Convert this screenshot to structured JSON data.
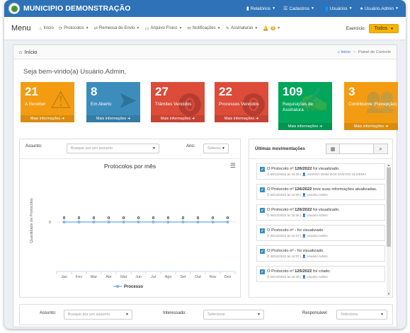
{
  "brand": {
    "name": "MUNICIPIO DEMONSTRAÇÃO"
  },
  "top_nav": [
    {
      "icon": "bar-chart-icon",
      "glyph": "▮",
      "label": "Relatórios"
    },
    {
      "icon": "sitemap-icon",
      "glyph": "☰",
      "label": "Cadastros"
    },
    {
      "icon": "users-icon",
      "glyph": "👥",
      "label": "Usuários"
    },
    {
      "icon": "user-icon",
      "glyph": "●",
      "label": "Usuário.Admin"
    }
  ],
  "menu": {
    "title": "Menu",
    "items": [
      {
        "label": "Início",
        "glyph": "⌂"
      },
      {
        "label": "Protocolos",
        "glyph": "⟳"
      },
      {
        "label": "Remessa de Envio",
        "glyph": "⇄"
      },
      {
        "label": "Arquivo Físico",
        "glyph": "▭"
      },
      {
        "label": "Notificações",
        "glyph": "✉"
      },
      {
        "label": "Assinaturas",
        "glyph": "✎"
      }
    ],
    "bell_count": "0"
  },
  "exercicio": {
    "label": "Exercício:",
    "value": "Todos"
  },
  "panel": {
    "title": "Início",
    "breadcrumb_home": "Início",
    "breadcrumb_current": "Painel de Controle"
  },
  "welcome": "Seja bem-vindo(a) Usuário.Admin,",
  "boxes": [
    {
      "value": "21",
      "label": "A Receber",
      "footer": "Mais informações ➜"
    },
    {
      "value": "8",
      "label": "Em Aberto",
      "footer": "Mais informações ➜"
    },
    {
      "value": "27",
      "label": "Trâmites Vencidos",
      "footer": "Mais informações ➜"
    },
    {
      "value": "22",
      "label": "Processos Vencidos",
      "footer": "Mais informações ➜"
    },
    {
      "value": "109",
      "label": "Requisições de Assinatura",
      "footer": "Mais informações ➜"
    },
    {
      "value": "3",
      "label": "Contribuinte (Recepção)",
      "footer": "Mais informações ➜"
    }
  ],
  "chart_filters": {
    "assunto_label": "Assunto:",
    "assunto_placeholder": "Busque por um assunto",
    "ano_label": "Ano:",
    "ano_value": "Selecio..."
  },
  "chart_data": {
    "type": "line",
    "title": "Protocolos por mês",
    "categories": [
      "Jan",
      "Fev",
      "Mar",
      "Abr",
      "Mai",
      "Jun",
      "Jul",
      "Ago",
      "Set",
      "Out",
      "Nov",
      "Dez"
    ],
    "series": [
      {
        "name": "Processo",
        "values": [
          0,
          0,
          0,
          0,
          0,
          0,
          0,
          0,
          0,
          0,
          0,
          0
        ]
      }
    ],
    "xlabel": "",
    "ylabel": "Quantidade de Protocolos",
    "yticks": [
      "0"
    ],
    "grid": true,
    "legend": "bottom",
    "color": "#7cb5ec"
  },
  "moves": {
    "title": "Últimas movimentações",
    "items": [
      {
        "pre": "O Protocolo nº ",
        "bold": "126/2022",
        "post": " foi visualizado.",
        "meta": "⏱ 06/12/2022 às 16:39 | 👤 JOHNNY DINIZ DOS SANTOS OLIVEIRA"
      },
      {
        "pre": "O Protocolo nº ",
        "bold": "126/2022",
        "post": " teve suas informações atualizadas.",
        "meta": "⏱ 06/12/2022 às 16:39 | 👤 Usuário.Admin"
      },
      {
        "pre": "O Protocolo nº ",
        "bold": "126/2022",
        "post": " foi visualizado.",
        "meta": "⏱ 06/12/2022 às 16:38 | 👤 Usuário.Admin"
      },
      {
        "pre": "O Protocolo nº ",
        "bold": "-",
        "post": " foi visualizado.",
        "meta": "⏱ 06/12/2022 às 16:37 | 👤 Usuário.Admin"
      },
      {
        "pre": "O Protocolo nº ",
        "bold": "-",
        "post": " foi visualizado.",
        "meta": "⏱ 06/12/2022 às 16:37 | 👤 Usuário.Admin"
      },
      {
        "pre": "O Protocolo nº ",
        "bold": "125/2022",
        "post": " foi criado.",
        "meta": "⏱ 06/12/2022 às 16:36 | 👤 Usuário.Admin"
      }
    ]
  },
  "bottom_filters": {
    "assunto_label": "Assunto:",
    "assunto_placeholder": "Busque por um assunto",
    "interessado_label": "Interessado:",
    "interessado_value": "Selecione",
    "responsavel_label": "Responsável",
    "responsavel_value": "Selecione"
  }
}
